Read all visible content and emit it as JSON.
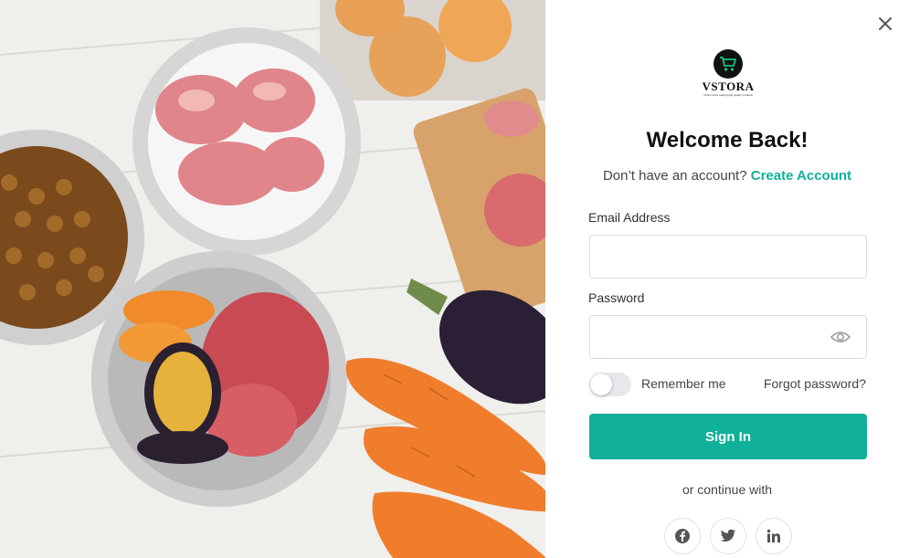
{
  "header": {
    "title": "Welcome Back!",
    "subtitle_text": "Don’t have an account?",
    "create_account_link": "Create Account"
  },
  "logo": {
    "brand": "VSTORA",
    "tagline": "Online store selling high quality products"
  },
  "form": {
    "email_label": "Email Address",
    "email_value": "",
    "password_label": "Password",
    "password_value": "",
    "remember_label": "Remember me",
    "remember_checked": false,
    "forgot_link": "Forgot password?",
    "signin_label": "Sign In"
  },
  "social": {
    "divider_text": "or continue with",
    "providers": [
      "facebook-icon",
      "twitter-icon",
      "linkedin-icon"
    ]
  },
  "icons": {
    "close": "close-icon",
    "cart": "cart-icon",
    "eye": "eye-icon"
  },
  "colors": {
    "accent": "#10b09a",
    "text_dark": "#111111",
    "text_muted": "#444444",
    "border": "#d8dbe0"
  }
}
